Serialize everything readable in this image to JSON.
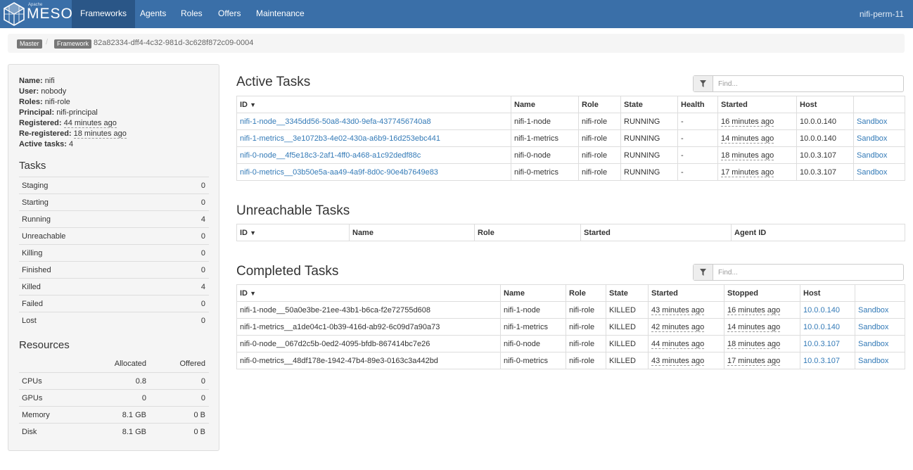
{
  "navbar": {
    "brand_small": "Apache",
    "brand": "MESOS",
    "links": [
      "Frameworks",
      "Agents",
      "Roles",
      "Offers",
      "Maintenance"
    ],
    "active": "Frameworks",
    "cluster": "nifi-perm-11"
  },
  "breadcrumb": {
    "master": "Master",
    "separator": "/",
    "framework": "Framework",
    "framework_id": "82a82334-dff4-4c32-981d-3c628f872c09-0004"
  },
  "sidebar": {
    "info": {
      "name_label": "Name:",
      "name": "nifi",
      "user_label": "User:",
      "user": "nobody",
      "roles_label": "Roles:",
      "roles": "nifi-role",
      "principal_label": "Principal:",
      "principal": "nifi-principal",
      "registered_label": "Registered:",
      "registered": "44 minutes ago",
      "reregistered_label": "Re-registered:",
      "reregistered": "18 minutes ago",
      "active_tasks_label": "Active tasks:",
      "active_tasks": "4"
    },
    "tasks_title": "Tasks",
    "tasks": [
      {
        "label": "Staging",
        "value": "0"
      },
      {
        "label": "Starting",
        "value": "0"
      },
      {
        "label": "Running",
        "value": "4"
      },
      {
        "label": "Unreachable",
        "value": "0"
      },
      {
        "label": "Killing",
        "value": "0"
      },
      {
        "label": "Finished",
        "value": "0"
      },
      {
        "label": "Killed",
        "value": "4"
      },
      {
        "label": "Failed",
        "value": "0"
      },
      {
        "label": "Lost",
        "value": "0"
      }
    ],
    "resources_title": "Resources",
    "resources_headers": {
      "allocated": "Allocated",
      "offered": "Offered"
    },
    "resources": [
      {
        "label": "CPUs",
        "allocated": "0.8",
        "offered": "0"
      },
      {
        "label": "GPUs",
        "allocated": "0",
        "offered": "0"
      },
      {
        "label": "Memory",
        "allocated": "8.1 GB",
        "offered": "0 B"
      },
      {
        "label": "Disk",
        "allocated": "8.1 GB",
        "offered": "0 B"
      }
    ]
  },
  "active_tasks": {
    "title": "Active Tasks",
    "search_placeholder": "Find...",
    "headers": {
      "id": "ID",
      "sort": "▼",
      "name": "Name",
      "role": "Role",
      "state": "State",
      "health": "Health",
      "started": "Started",
      "host": "Host"
    },
    "rows": [
      {
        "id": "nifi-1-node__3345dd56-50a8-43d0-9efa-4377456740a8",
        "name": "nifi-1-node",
        "role": "nifi-role",
        "state": "RUNNING",
        "health": "-",
        "started": "16 minutes ago",
        "host": "10.0.0.140",
        "sandbox": "Sandbox"
      },
      {
        "id": "nifi-1-metrics__3e1072b3-4e02-430a-a6b9-16d253ebc441",
        "name": "nifi-1-metrics",
        "role": "nifi-role",
        "state": "RUNNING",
        "health": "-",
        "started": "14 minutes ago",
        "host": "10.0.0.140",
        "sandbox": "Sandbox"
      },
      {
        "id": "nifi-0-node__4f5e18c3-2af1-4ff0-a468-a1c92dedf88c",
        "name": "nifi-0-node",
        "role": "nifi-role",
        "state": "RUNNING",
        "health": "-",
        "started": "18 minutes ago",
        "host": "10.0.3.107",
        "sandbox": "Sandbox"
      },
      {
        "id": "nifi-0-metrics__03b50e5a-aa49-4a9f-8d0c-90e4b7649e83",
        "name": "nifi-0-metrics",
        "role": "nifi-role",
        "state": "RUNNING",
        "health": "-",
        "started": "17 minutes ago",
        "host": "10.0.3.107",
        "sandbox": "Sandbox"
      }
    ]
  },
  "unreachable_tasks": {
    "title": "Unreachable Tasks",
    "headers": {
      "id": "ID",
      "sort": "▼",
      "name": "Name",
      "role": "Role",
      "started": "Started",
      "agent_id": "Agent ID"
    }
  },
  "completed_tasks": {
    "title": "Completed Tasks",
    "search_placeholder": "Find...",
    "headers": {
      "id": "ID",
      "sort": "▼",
      "name": "Name",
      "role": "Role",
      "state": "State",
      "started": "Started",
      "stopped": "Stopped",
      "host": "Host"
    },
    "rows": [
      {
        "id": "nifi-1-node__50a0e3be-21ee-43b1-b6ca-f2e72755d608",
        "name": "nifi-1-node",
        "role": "nifi-role",
        "state": "KILLED",
        "started": "43 minutes ago",
        "stopped": "16 minutes ago",
        "host": "10.0.0.140",
        "sandbox": "Sandbox"
      },
      {
        "id": "nifi-1-metrics__a1de04c1-0b39-416d-ab92-6c09d7a90a73",
        "name": "nifi-1-metrics",
        "role": "nifi-role",
        "state": "KILLED",
        "started": "42 minutes ago",
        "stopped": "14 minutes ago",
        "host": "10.0.0.140",
        "sandbox": "Sandbox"
      },
      {
        "id": "nifi-0-node__067d2c5b-0ed2-4095-bfdb-867414bc7e26",
        "name": "nifi-0-node",
        "role": "nifi-role",
        "state": "KILLED",
        "started": "44 minutes ago",
        "stopped": "18 minutes ago",
        "host": "10.0.3.107",
        "sandbox": "Sandbox"
      },
      {
        "id": "nifi-0-metrics__48df178e-1942-47b4-89e3-0163c3a442bd",
        "name": "nifi-0-metrics",
        "role": "nifi-role",
        "state": "KILLED",
        "started": "43 minutes ago",
        "stopped": "17 minutes ago",
        "host": "10.0.3.107",
        "sandbox": "Sandbox"
      }
    ]
  }
}
